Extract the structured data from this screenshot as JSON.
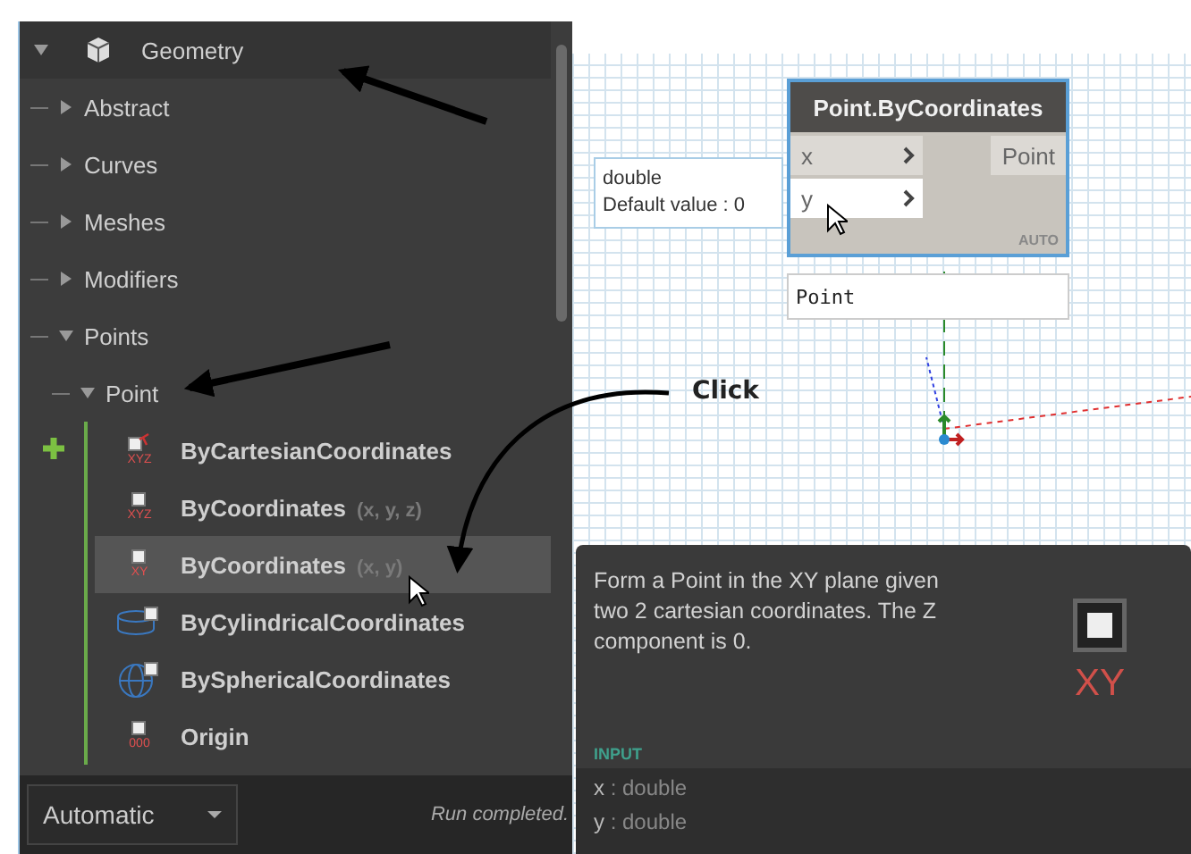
{
  "library": {
    "root": {
      "label": "Geometry",
      "expanded": true,
      "children": [
        {
          "label": "Abstract",
          "kind": "category",
          "expanded": false
        },
        {
          "label": "Curves",
          "kind": "category",
          "expanded": false
        },
        {
          "label": "Meshes",
          "kind": "category",
          "expanded": false
        },
        {
          "label": "Modifiers",
          "kind": "category",
          "expanded": false
        },
        {
          "label": "Points",
          "kind": "category",
          "expanded": true,
          "children": [
            {
              "label": "Point",
              "kind": "class",
              "expanded": true,
              "members": [
                {
                  "name": "ByCartesianCoordinates",
                  "kind": "cartesian",
                  "icon_label": "XYZ",
                  "selected": false
                },
                {
                  "name": "ByCoordinates",
                  "params": "(x, y, z)",
                  "kind": "point",
                  "icon_label": "XYZ",
                  "selected": false
                },
                {
                  "name": "ByCoordinates",
                  "params": "(x, y)",
                  "kind": "point",
                  "icon_label": "XY",
                  "selected": true
                },
                {
                  "name": "ByCylindricalCoordinates",
                  "kind": "cylinder",
                  "selected": false
                },
                {
                  "name": "BySphericalCoordinates",
                  "kind": "sphere",
                  "selected": false
                },
                {
                  "name": "Origin",
                  "kind": "point",
                  "icon_label": "000",
                  "selected": false
                }
              ]
            }
          ]
        }
      ]
    }
  },
  "run_bar": {
    "mode": "Automatic",
    "status": "Run completed."
  },
  "node": {
    "title": "Point.ByCoordinates",
    "inputs": [
      {
        "name": "x",
        "hovered": false
      },
      {
        "name": "y",
        "hovered": true
      }
    ],
    "output": "Point",
    "lacing": "AUTO",
    "tooltip": [
      "double",
      "Default value : 0"
    ],
    "preview": "Point"
  },
  "annotation": "Click",
  "description": {
    "text": "Form a Point in the XY plane given two 2 cartesian coordinates. The Z component is 0.",
    "icon_label": "XY",
    "section": "INPUT",
    "inputs": [
      {
        "name": "x",
        "detail": ": double"
      },
      {
        "name": "y",
        "detail": ": double"
      }
    ]
  }
}
